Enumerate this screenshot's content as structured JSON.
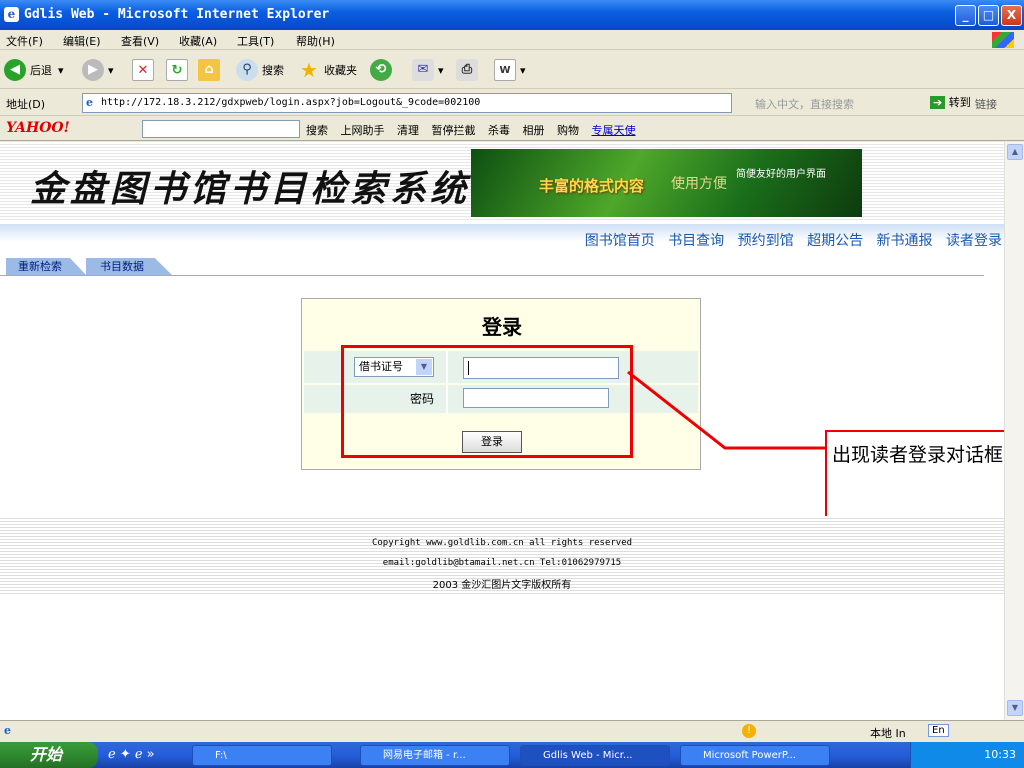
{
  "window": {
    "title": "Gdlis Web - Microsoft Internet Explorer",
    "buttons": [
      "_",
      "□",
      "X"
    ]
  },
  "menu": [
    "文件(F)",
    "编辑(E)",
    "查看(V)",
    "收藏(A)",
    "工具(T)",
    "帮助(H)"
  ],
  "toolbar": {
    "back": "后退",
    "search": "搜索",
    "favorites": "收藏夹"
  },
  "address": {
    "label": "地址(D)",
    "url": "http://172.18.3.212/gdxpweb/login.aspx?job=Logout&_9code=002100",
    "hint": "输入中文，直接搜索",
    "go": "转到",
    "links": "链接"
  },
  "yahoo": {
    "logo": "YAHOO!",
    "items": [
      "搜索",
      "上网助手",
      "清理",
      "暂停拦截",
      "杀毒",
      "相册",
      "购物",
      "专属天使"
    ]
  },
  "site": {
    "logo": "金盘图书馆书目检索系统",
    "banner": {
      "main": "丰富的格式内容",
      "sub": "使用方便",
      "small": "简便友好的用户界面"
    },
    "nav": [
      "图书馆首页",
      "书目查询",
      "预约到馆",
      "超期公告",
      "新书通报",
      "读者登录"
    ],
    "tabs": [
      "重新检索",
      "书目数据"
    ]
  },
  "login": {
    "title": "登录",
    "select_value": "借书证号",
    "password_label": "密码",
    "submit": "登录"
  },
  "annotation": "出现读者登录对话框",
  "footer": {
    "line1": "Copyright www.goldlib.com.cn all rights reserved",
    "line2": "email:goldlib@btamail.net.cn  Tel:01062979715",
    "line3": "2003 金沙汇图片文字版权所有"
  },
  "status": {
    "zone": "本地 In",
    "lang": "En"
  },
  "taskbar": {
    "start": "开始",
    "tasks": [
      "F:\\",
      "网易电子邮箱 - r...",
      "Gdlis Web - Micr...",
      "Microsoft PowerP..."
    ],
    "time": "10:33"
  }
}
